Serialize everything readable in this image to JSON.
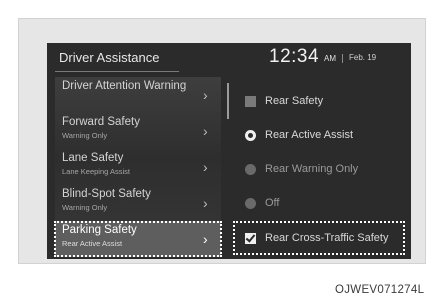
{
  "header": {
    "title": "Driver Assistance",
    "time": "12:34",
    "ampm": "AM",
    "date": "Feb. 19"
  },
  "menu": {
    "items": [
      {
        "label": "Driver Attention Warning",
        "sub": ""
      },
      {
        "label": "Forward Safety",
        "sub": "Warning Only"
      },
      {
        "label": "Lane Safety",
        "sub": "Lane Keeping Assist"
      },
      {
        "label": "Blind-Spot Safety",
        "sub": "Warning Only"
      },
      {
        "label": "Parking Safety",
        "sub": "Rear Active Assist"
      }
    ],
    "chevron": "›"
  },
  "options": {
    "rear_safety": "Rear Safety",
    "rear_active_assist": "Rear Active Assist",
    "rear_warning_only": "Rear Warning Only",
    "off": "Off",
    "rear_cross_traffic": "Rear Cross-Traffic Safety"
  },
  "figure_code": "OJWEV071274L",
  "icons": {
    "chevron": "chevron-right-icon",
    "checkbox": "checkbox-icon",
    "radio": "radio-icon"
  },
  "colors": {
    "screen_bg": "#2b2b2b",
    "active_item_bg": "#5e5e5e",
    "text": "#d4d4d4",
    "highlight_border": "#ffffff"
  }
}
